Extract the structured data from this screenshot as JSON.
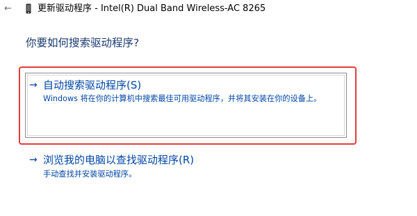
{
  "window": {
    "back_glyph": "←",
    "back_icon": "back-arrow-icon",
    "device_icon": "device-icon",
    "title": "更新驱动程序 - Intel(R) Dual Band Wireless-AC 8265"
  },
  "main": {
    "heading": "你要如何搜索驱动程序?",
    "options": [
      {
        "arrow": "→",
        "title": "自动搜索驱动程序(S)",
        "description": "Windows 将在你的计算机中搜索最佳可用驱动程序，并将其安装在你的设备上。"
      },
      {
        "arrow": "→",
        "title": "浏览我的电脑以查找驱动程序(R)",
        "description": "手动查找并安装驱动程序。"
      }
    ]
  },
  "colors": {
    "link": "#0045a5",
    "heading": "#1c3a70",
    "highlight_frame": "#e23b3b"
  }
}
